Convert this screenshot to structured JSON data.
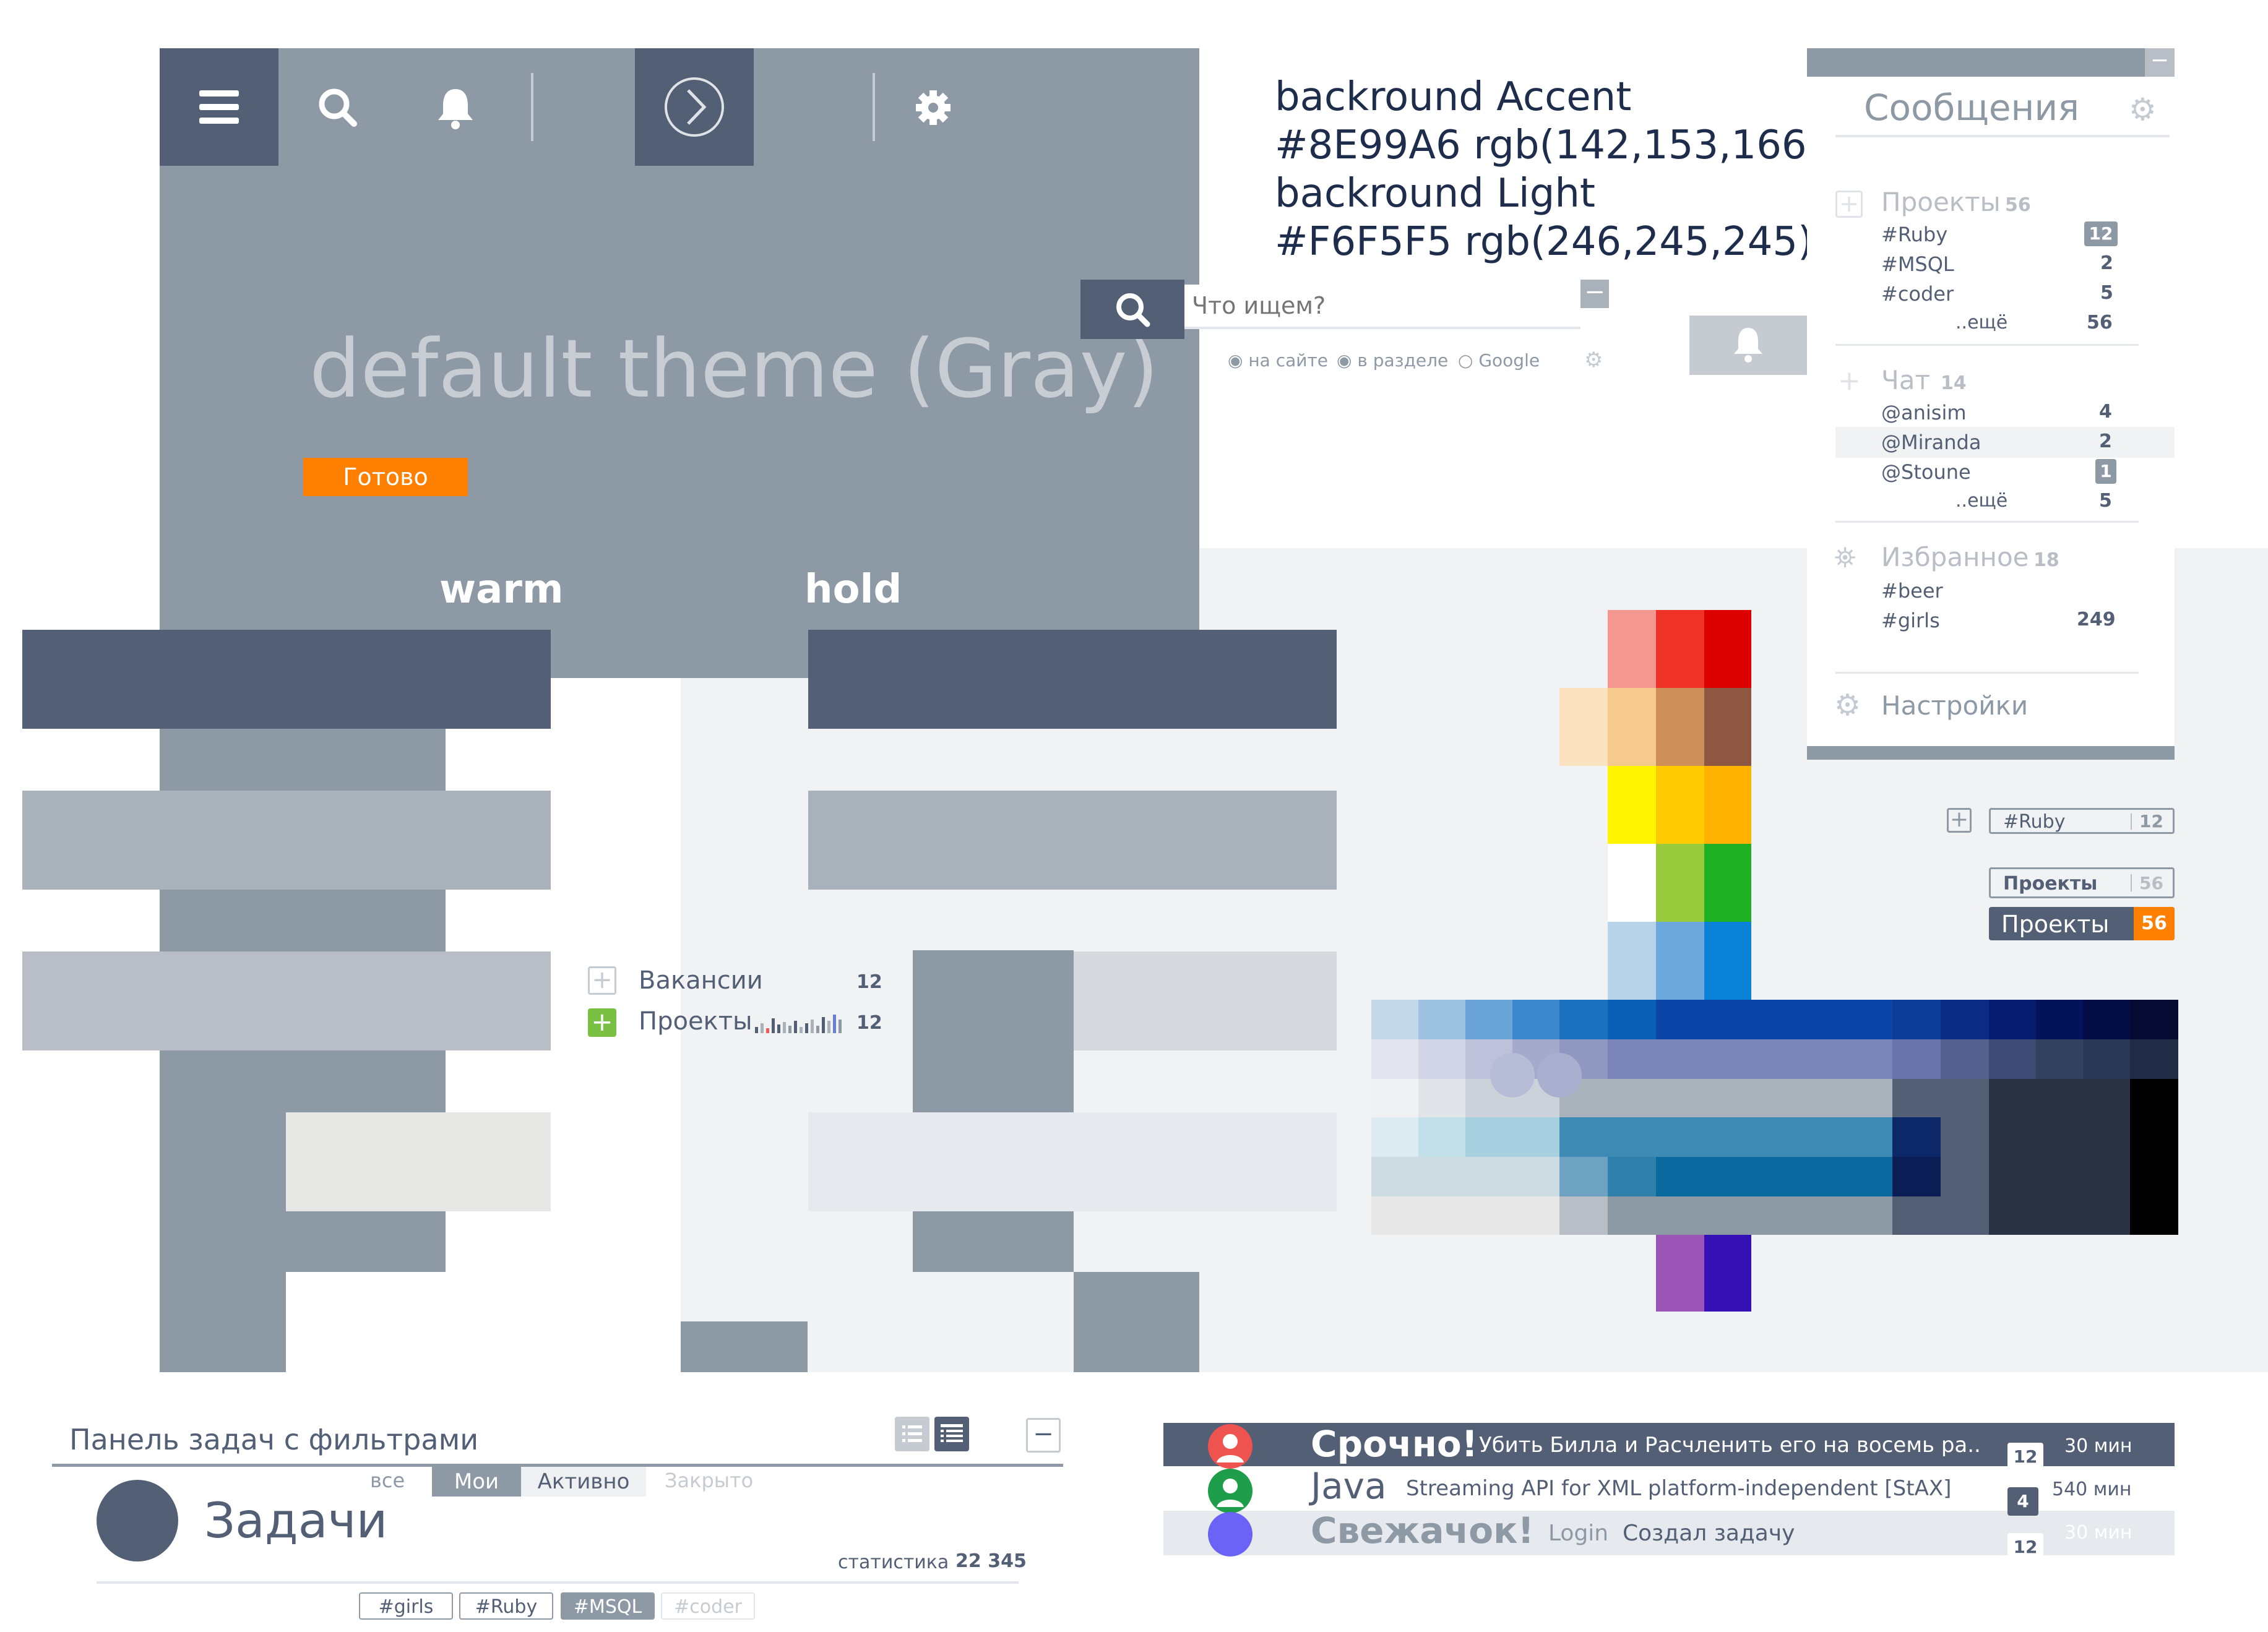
{
  "colors": {
    "accent": "#8E99A6",
    "light": "#F6F5F5",
    "dark": "#525f75",
    "orange": "#ff7f00"
  },
  "theme": {
    "title": "default theme (Gray)",
    "ready_button": "Готово",
    "warm_label": "warm",
    "hold_label": "hold"
  },
  "toolbar": {
    "icons": [
      "menu-icon",
      "search-icon",
      "bell-icon",
      "arrow-right-circle-icon",
      "gear-icon"
    ]
  },
  "notes": {
    "line1": "backround Accent",
    "line2": "#8E99A6 rgb(142,153,166)",
    "line3": "backround Light",
    "line4": "#F6F5F5 rgb(246,245,245)"
  },
  "search": {
    "placeholder": "Что ищем?",
    "options": [
      "на сайте",
      "в разделе",
      "Google"
    ]
  },
  "messages": {
    "title": "Сообщения",
    "projects": {
      "label": "Проекты",
      "count": "56",
      "items": [
        {
          "name": "#Ruby",
          "count": "12"
        },
        {
          "name": "#MSQL",
          "count": "2"
        },
        {
          "name": "#coder",
          "count": "5"
        },
        {
          "name": "..ещё",
          "count": "56"
        }
      ]
    },
    "chat": {
      "label": "Чат",
      "count": "14",
      "items": [
        {
          "name": "@anisim",
          "count": "4"
        },
        {
          "name": "@Miranda",
          "count": "2"
        },
        {
          "name": "@Stoune",
          "count": "1"
        },
        {
          "name": "..ещё",
          "count": "5"
        }
      ]
    },
    "favorites": {
      "label": "Избранное",
      "count": "18",
      "items": [
        {
          "name": "#beer",
          "count": ""
        },
        {
          "name": "#girls",
          "count": "249"
        }
      ]
    },
    "settings": "Настройки"
  },
  "chips": {
    "ruby_tag": "#Ruby",
    "ruby_count": "12",
    "projects_label": "Проекты",
    "projects_count": "56",
    "projects_dark_label": "Проекты",
    "projects_dark_count": "56"
  },
  "sidelist": {
    "vacancies": "Вакансии",
    "vacancies_count": "12",
    "projects": "Проекты",
    "projects_count": "12"
  },
  "tasks": {
    "panel_title": "Панель задач с фильтрами",
    "filters": [
      "все",
      "Мои",
      "Активно",
      "Закрыто"
    ],
    "title": "Задачи",
    "stats_label": "статистика",
    "stats_value": "22 345",
    "tags": [
      "#girls",
      "#Ruby",
      "#MSQL",
      "#coder"
    ]
  },
  "feed": [
    {
      "title": "Срочно!",
      "text": "Убить Билла и Расчленить его на восемь ра..",
      "count": "12",
      "time": "30 мин",
      "avatar": "#ef5350"
    },
    {
      "title": "Java",
      "text": "Streaming API for XML platform-independent [StAX]",
      "count": "4",
      "time": "540 мин",
      "avatar": "#1e9e4a"
    },
    {
      "title": "Свежачок!",
      "login": "Login",
      "text": "Создал задачу",
      "count": "12",
      "time": "30 мин",
      "avatar": "#6b63f5"
    }
  ]
}
